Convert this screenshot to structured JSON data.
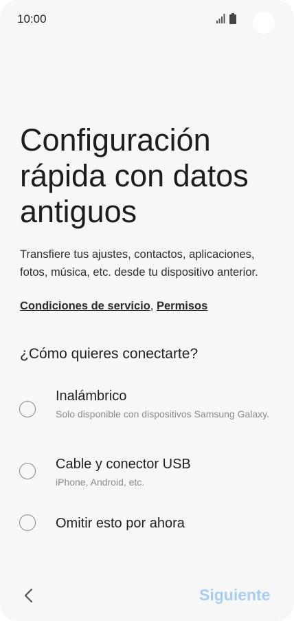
{
  "status_bar": {
    "time": "10:00"
  },
  "title": "Configuración rápida con datos antiguos",
  "description": "Transfiere tus ajustes, contactos, aplicaciones, fotos, música, etc. desde tu dispositivo anterior.",
  "links": {
    "terms": "Condiciones de servicio",
    "separator": ",",
    "permissions": "Permisos"
  },
  "question": "¿Cómo quieres conectarte?",
  "options": [
    {
      "label": "Inalámbrico",
      "sub": "Solo disponible con dispositivos Samsung Galaxy."
    },
    {
      "label": "Cable y conector USB",
      "sub": "iPhone, Android, etc."
    },
    {
      "label": "Omitir esto por ahora",
      "sub": ""
    }
  ],
  "nav": {
    "next_label": "Siguiente"
  },
  "icons": {
    "back": "chevron-left-icon",
    "signal": "signal-icon",
    "battery": "battery-icon"
  },
  "colors": {
    "accent_disabled": "#a7cdf0",
    "background": "#f7f7f7"
  }
}
